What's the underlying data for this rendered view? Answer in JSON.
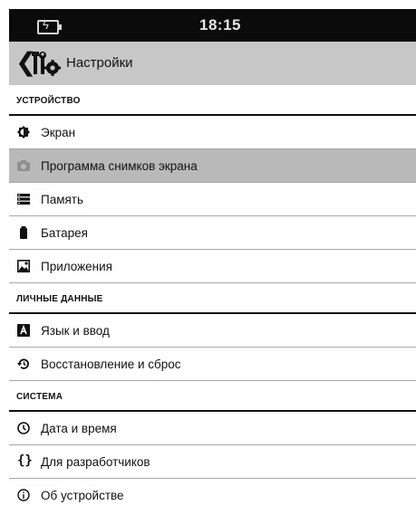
{
  "status_bar": {
    "time": "18:15",
    "battery_icon": "battery-charging-icon"
  },
  "app_bar": {
    "back_icon": "chevron-left-icon",
    "app_icon": "settings-tools-icon",
    "title": "Настройки"
  },
  "sections": [
    {
      "header": "УСТРОЙСТВО",
      "items": [
        {
          "label": "Экран",
          "icon": "brightness-icon"
        },
        {
          "label": "Программа снимков экрана",
          "icon": "camera-icon",
          "selected": true
        },
        {
          "label": "Память",
          "icon": "storage-icon"
        },
        {
          "label": "Батарея",
          "icon": "battery-icon"
        },
        {
          "label": "Приложения",
          "icon": "apps-icon"
        }
      ]
    },
    {
      "header": "ЛИЧНЫЕ ДАННЫЕ",
      "items": [
        {
          "label": "Язык и ввод",
          "icon": "language-icon"
        },
        {
          "label": "Восстановление и сброс",
          "icon": "restore-icon"
        }
      ]
    },
    {
      "header": "СИСТЕМА",
      "items": [
        {
          "label": "Дата и время",
          "icon": "clock-icon"
        },
        {
          "label": "Для разработчиков",
          "icon": "braces-icon"
        },
        {
          "label": "Об устройстве",
          "icon": "info-icon"
        }
      ]
    }
  ]
}
